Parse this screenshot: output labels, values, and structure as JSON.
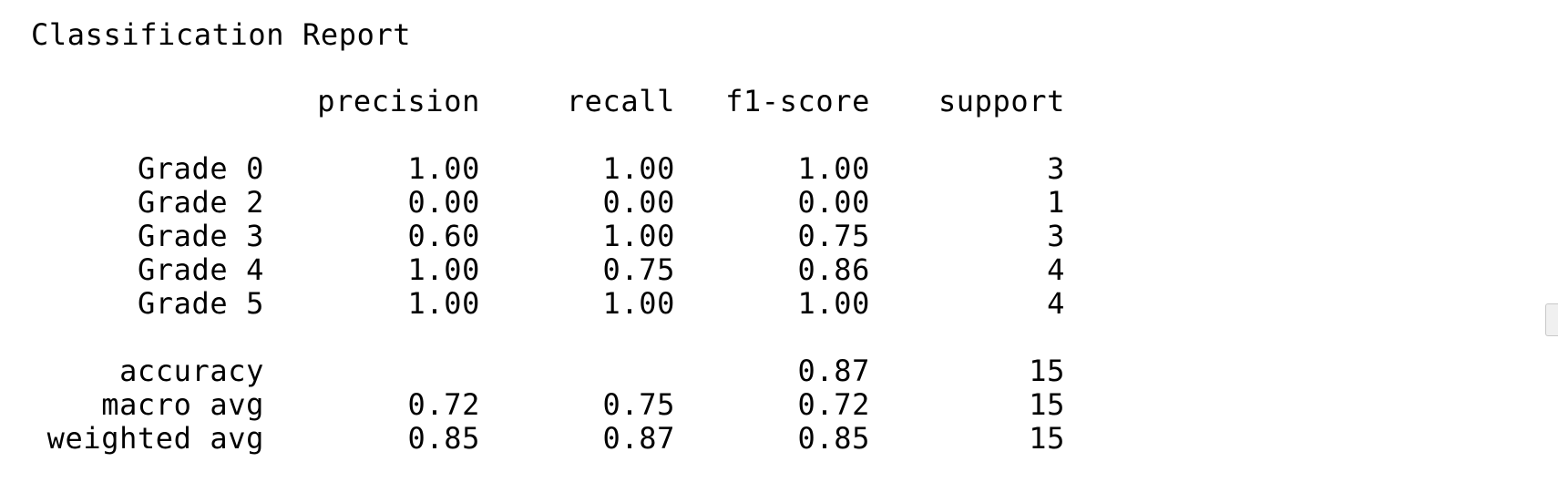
{
  "report": {
    "title": "Classification Report",
    "columns": [
      "precision",
      "recall",
      "f1-score",
      "support"
    ],
    "classes": [
      {
        "label": "Grade 0",
        "precision": "1.00",
        "recall": "1.00",
        "f1": "1.00",
        "support": "3"
      },
      {
        "label": "Grade 2",
        "precision": "0.00",
        "recall": "0.00",
        "f1": "0.00",
        "support": "1"
      },
      {
        "label": "Grade 3",
        "precision": "0.60",
        "recall": "1.00",
        "f1": "0.75",
        "support": "3"
      },
      {
        "label": "Grade 4",
        "precision": "1.00",
        "recall": "0.75",
        "f1": "0.86",
        "support": "4"
      },
      {
        "label": "Grade 5",
        "precision": "1.00",
        "recall": "1.00",
        "f1": "1.00",
        "support": "4"
      }
    ],
    "summary": [
      {
        "label": "accuracy",
        "precision": "",
        "recall": "",
        "f1": "0.87",
        "support": "15"
      },
      {
        "label": "macro avg",
        "precision": "0.72",
        "recall": "0.75",
        "f1": "0.72",
        "support": "15"
      },
      {
        "label": "weighted avg",
        "precision": "0.85",
        "recall": "0.87",
        "f1": "0.85",
        "support": "15"
      }
    ]
  }
}
